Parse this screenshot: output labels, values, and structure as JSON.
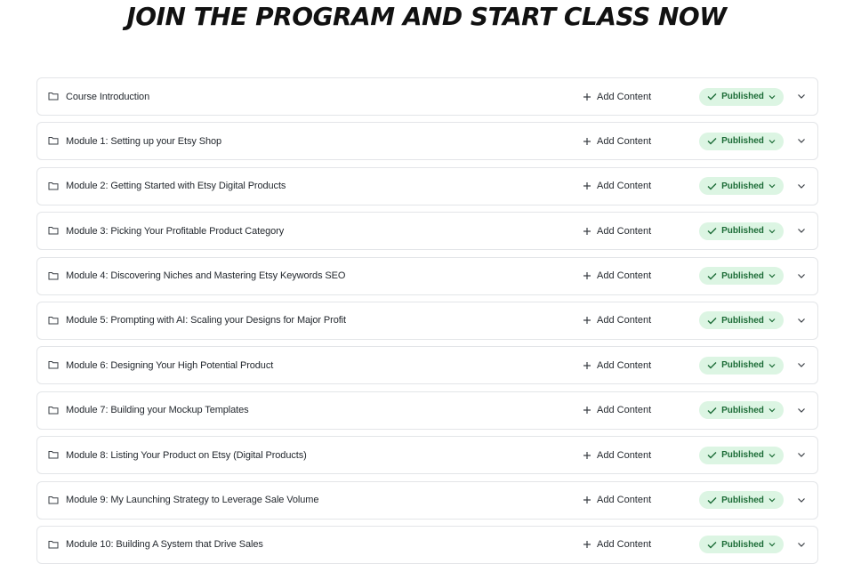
{
  "header": {
    "title": "JOIN THE PROGRAM AND START CLASS NOW"
  },
  "labels": {
    "add_content": "Add Content",
    "status": "Published"
  },
  "colors": {
    "badge_bg": "#dcf5e3",
    "badge_text": "#1b6b36",
    "border": "#e3e5e8"
  },
  "icons": {
    "row": "folder-icon",
    "add": "plus-icon",
    "status": "check-icon",
    "expand": "chevron-down-icon"
  },
  "modules": [
    {
      "title": "Course Introduction"
    },
    {
      "title": "Module 1: Setting up your Etsy Shop"
    },
    {
      "title": "Module 2: Getting Started with Etsy Digital Products"
    },
    {
      "title": "Module 3: Picking Your Profitable Product Category"
    },
    {
      "title": "Module 4: Discovering Niches and Mastering Etsy Keywords SEO"
    },
    {
      "title": "Module 5: Prompting with AI: Scaling your Designs for Major Profit"
    },
    {
      "title": "Module 6: Designing Your High Potential Product"
    },
    {
      "title": "Module 7: Building your Mockup Templates"
    },
    {
      "title": "Module 8: Listing Your Product on Etsy (Digital Products)"
    },
    {
      "title": "Module 9: My Launching Strategy to Leverage Sale Volume"
    },
    {
      "title": "Module 10: Building A System that Drive Sales"
    }
  ]
}
